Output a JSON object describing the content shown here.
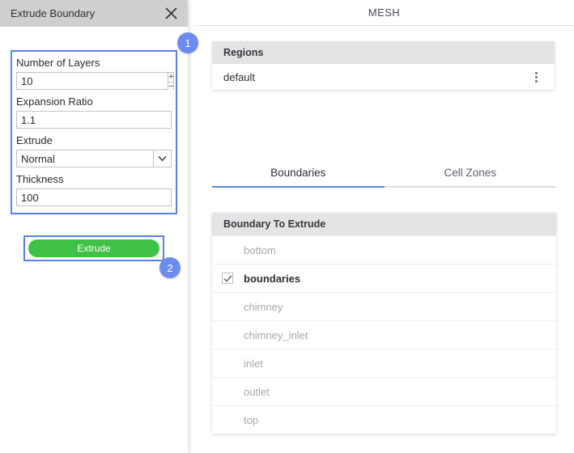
{
  "left_panel": {
    "title": "Extrude Boundary",
    "close_icon": "close-icon",
    "fields": [
      {
        "label": "Number of Layers",
        "value": "10",
        "type": "spinner",
        "plus": "+",
        "minus": "−"
      },
      {
        "label": "Expansion Ratio",
        "value": "1.1",
        "type": "text"
      },
      {
        "label": "Extrude",
        "value": "Normal",
        "type": "select"
      },
      {
        "label": "Thickness",
        "value": "100",
        "type": "text"
      }
    ],
    "extrude_button": "Extrude",
    "badges": [
      "1",
      "2"
    ],
    "accent_highlight": "#5b7fe8",
    "button_color": "#3ec144",
    "badge_color": "#6b8cee"
  },
  "right_panel": {
    "header_title": "MESH",
    "regions_card": {
      "header": "Regions",
      "rows": [
        {
          "name": "default",
          "menu_icon": "kebab-menu-icon"
        }
      ]
    },
    "tabs": [
      {
        "label": "Boundaries",
        "active": true
      },
      {
        "label": "Cell Zones",
        "active": false
      }
    ],
    "boundary_card": {
      "header": "Boundary To Extrude",
      "rows": [
        {
          "name": "bottom",
          "checked": false
        },
        {
          "name": "boundaries",
          "checked": true
        },
        {
          "name": "chimney",
          "checked": false
        },
        {
          "name": "chimney_inlet",
          "checked": false
        },
        {
          "name": "inlet",
          "checked": false
        },
        {
          "name": "outlet",
          "checked": false
        },
        {
          "name": "top",
          "checked": false
        }
      ]
    },
    "tab_accent": "#5b85e0"
  }
}
